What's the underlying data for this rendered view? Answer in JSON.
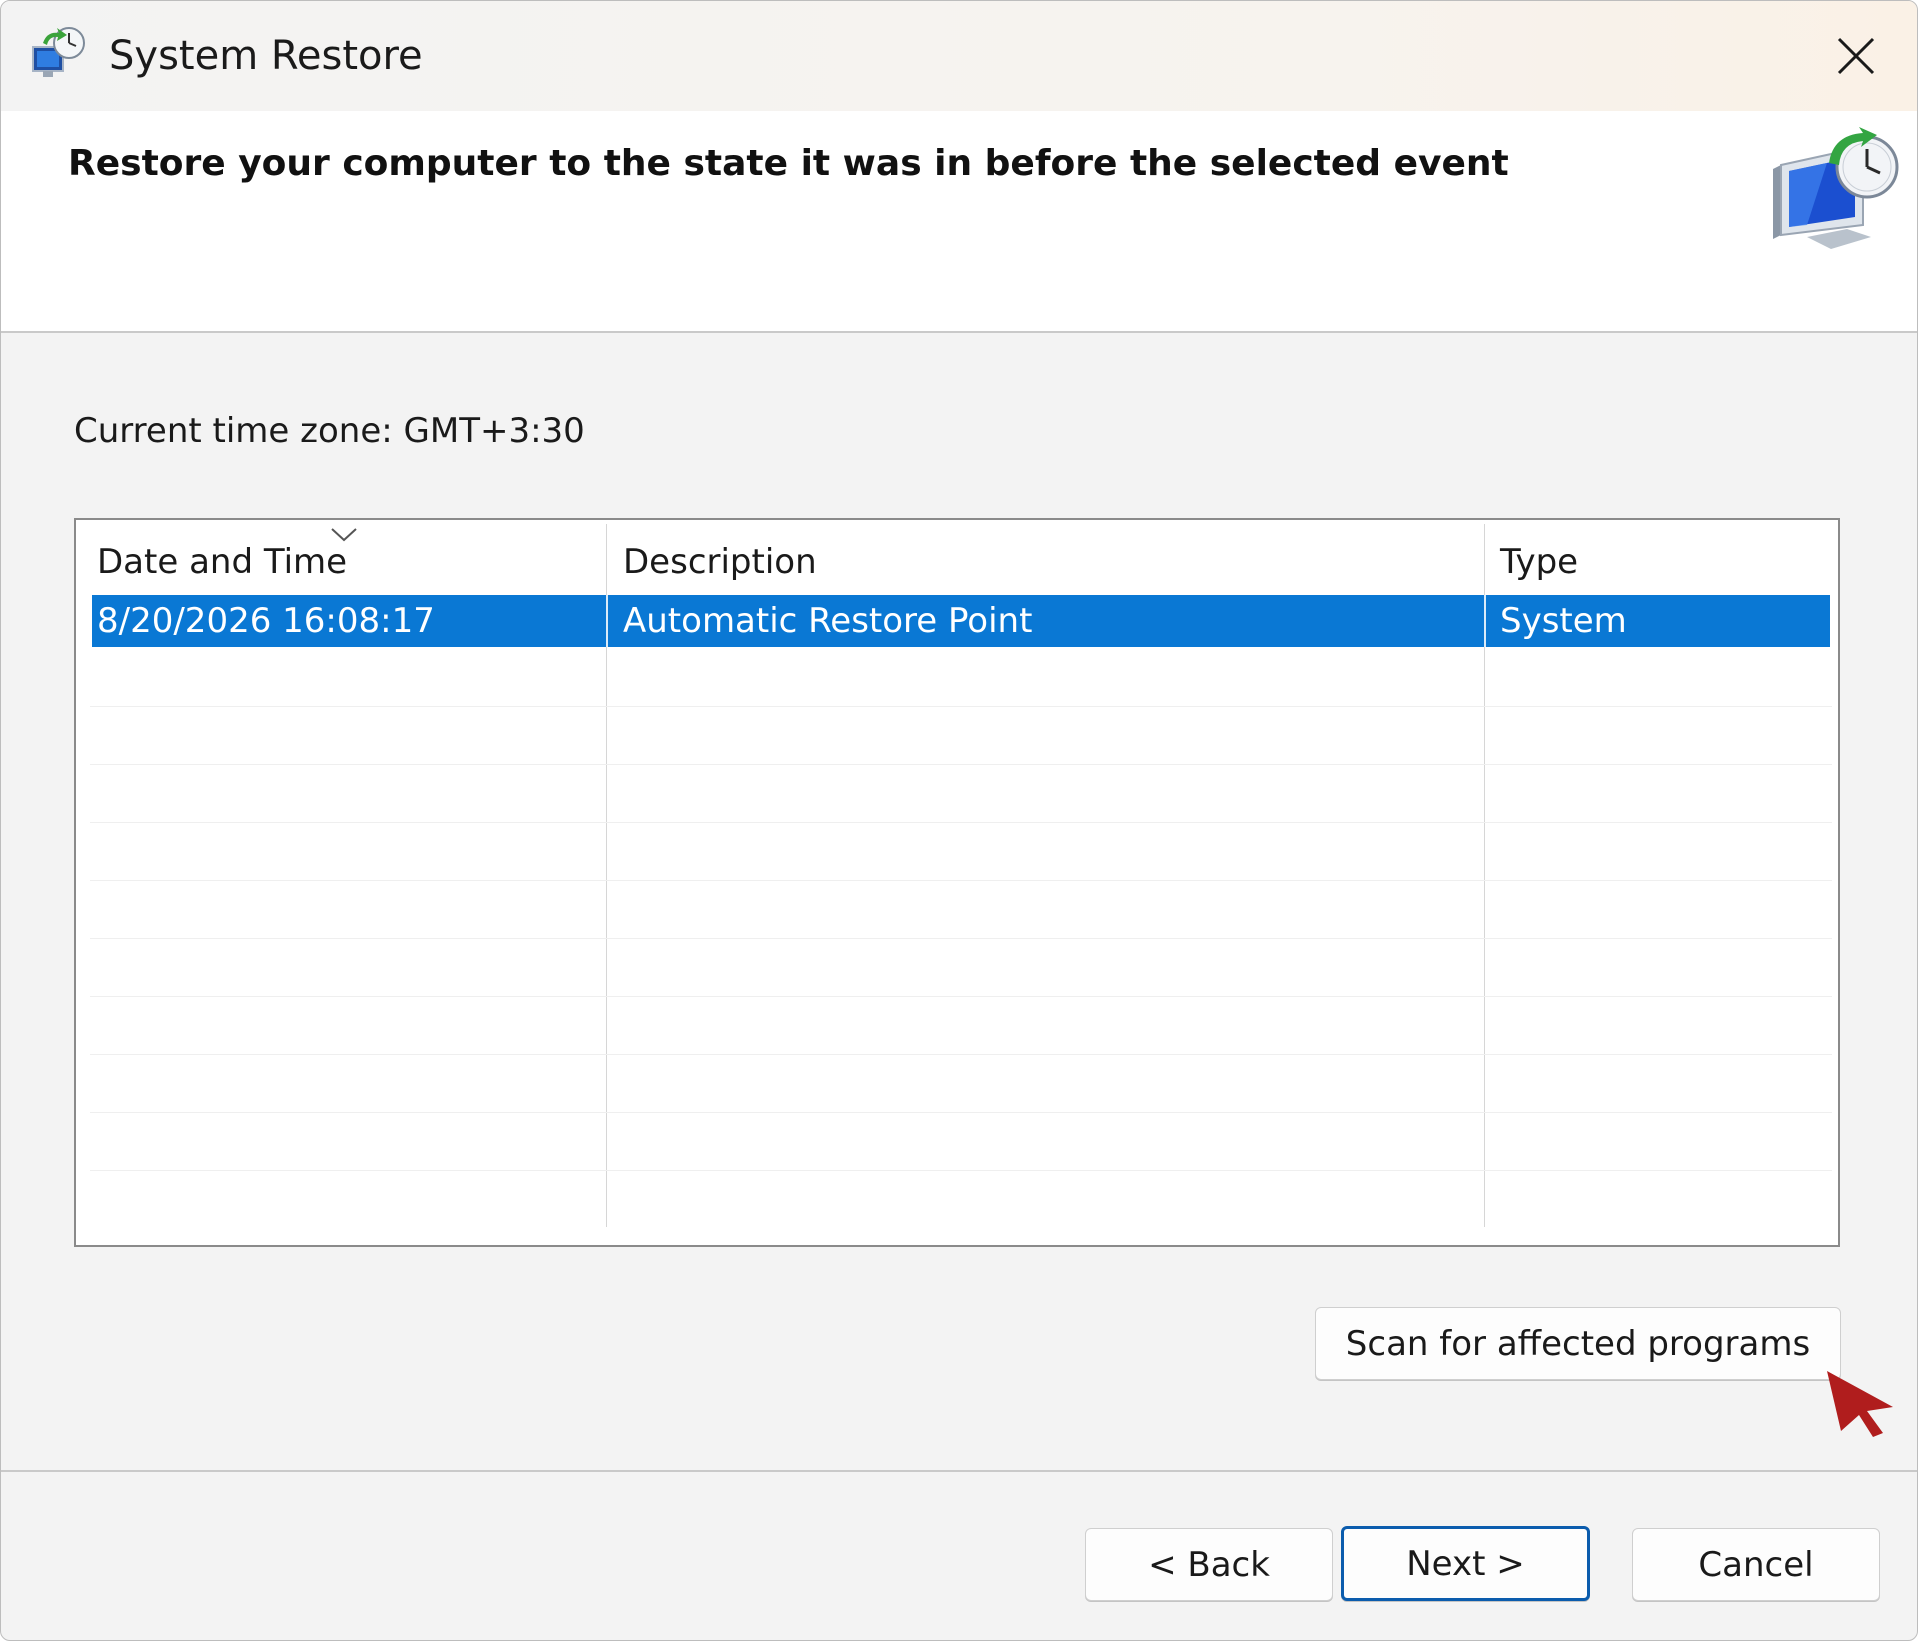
{
  "window": {
    "title": "System Restore",
    "app_icon": "system-restore-icon",
    "close_icon": "close-icon"
  },
  "header": {
    "heading": "Restore your computer to the state it was in before the selected event",
    "icon": "system-restore-monitor-icon"
  },
  "timezone": {
    "label": "Current time zone: GMT+3:30"
  },
  "table": {
    "columns": [
      "Date and Time",
      "Description",
      "Type"
    ],
    "sort_icon": "chevron-down-icon",
    "rows": [
      {
        "date_time": "8/20/2026 16:08:17",
        "description": "Automatic Restore Point",
        "type": "System",
        "selected": true
      }
    ]
  },
  "buttons": {
    "scan": "Scan for affected programs",
    "back": "< Back",
    "next": "Next >",
    "cancel": "Cancel"
  },
  "colors": {
    "selection": "#0a78d4",
    "default_button_border": "#0b5cad",
    "cursor": "#b01d1d"
  }
}
